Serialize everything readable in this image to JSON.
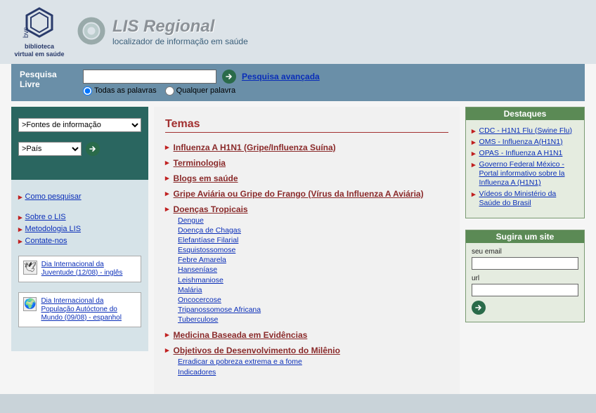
{
  "header": {
    "bvs_line1": "biblioteca",
    "bvs_line2": "virtual em saúde",
    "lis_title": "LIS Regional",
    "lis_subtitle": "localizador de informação em saúde"
  },
  "search": {
    "label_line1": "Pesquisa",
    "label_line2": "Livre",
    "value": "",
    "advanced": "Pesquisa avançada",
    "opt_all": "Todas as palavras",
    "opt_any": "Qualquer palavra"
  },
  "sidebar": {
    "select1": ">Fontes de informação",
    "select2": ">País",
    "how": "Como pesquisar",
    "links": [
      "Sobre o LIS",
      "Metodologia LIS",
      "Contate-nos"
    ],
    "news": [
      {
        "icon": "🕊",
        "text": "Dia Internacional da Juventude (12/08) - inglês"
      },
      {
        "icon": "🌍",
        "text": "Dia Internacional da População Autóctone do Mundo (09/08) - espanhol"
      }
    ]
  },
  "content": {
    "title": "Temas",
    "temas": [
      {
        "label": "Influenza A H1N1 (Gripe/Influenza Suína)",
        "subs": []
      },
      {
        "label": "Terminologia",
        "subs": []
      },
      {
        "label": "Blogs em saúde",
        "subs": []
      },
      {
        "label": "Gripe Aviária ou Gripe do Frango (Vírus da Influenza A Aviária)",
        "subs": []
      },
      {
        "label": "Doenças Tropicais",
        "subs": [
          "Dengue",
          "Doença de Chagas",
          "Elefantíase Filarial",
          "Esquistossomose",
          "Febre Amarela",
          "Hanseníase",
          "Leishmaniose",
          "Malária",
          "Oncocercose",
          "Tripanossomose Africana",
          "Tuberculose"
        ]
      },
      {
        "label": "Medicina Baseada em Evidências",
        "subs": []
      },
      {
        "label": "Objetivos de Desenvolvimento do Milênio",
        "subs": [
          "Erradicar a pobreza extrema e a fome",
          "Indicadores"
        ]
      }
    ]
  },
  "highlights": {
    "title": "Destaques",
    "items": [
      "CDC - H1N1 Flu (Swine Flu)",
      "OMS - Influenza A(H1N1)",
      "OPAS - Influenza A H1N1",
      "Governo Federal México - Portal informativo sobre la Influenza A (H1N1)",
      "Vídeos do Ministério da Saúde do Brasil"
    ]
  },
  "suggest": {
    "title": "Sugira um site",
    "email_label": "seu email",
    "url_label": "url"
  }
}
